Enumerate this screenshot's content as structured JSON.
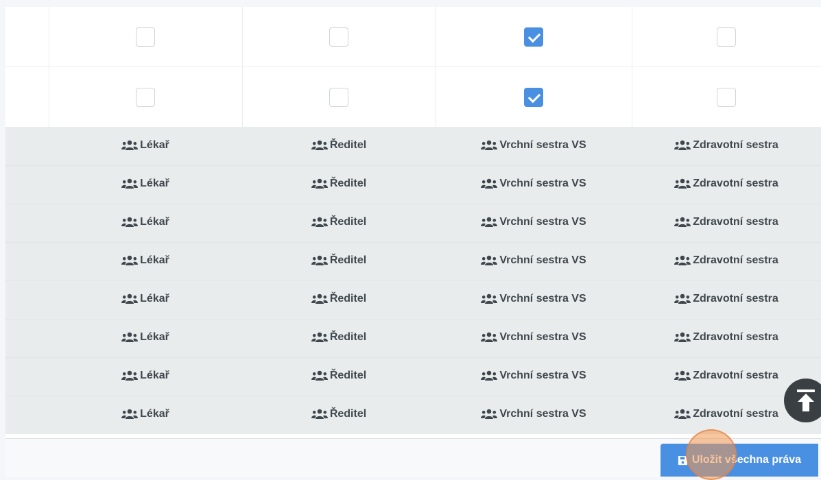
{
  "permissions": {
    "rows": [
      {
        "checked": [
          false,
          false,
          true,
          false
        ]
      },
      {
        "checked": [
          false,
          false,
          true,
          false
        ]
      }
    ]
  },
  "roles": {
    "icon": "users-icon",
    "labels": [
      "Lékař",
      "Ředitel",
      "Vrchní sestra VS",
      "Zdravotní sestra"
    ],
    "row_count": 8
  },
  "footer": {
    "save_label": "Uložit všechna práva",
    "save_icon": "save-icon"
  },
  "scroll_top_icon": "arrow-up-to-top-icon",
  "colors": {
    "accent": "#4a90e2",
    "role_row_bg": "#e9ecec",
    "scroll_top_bg": "#3a3f44"
  }
}
